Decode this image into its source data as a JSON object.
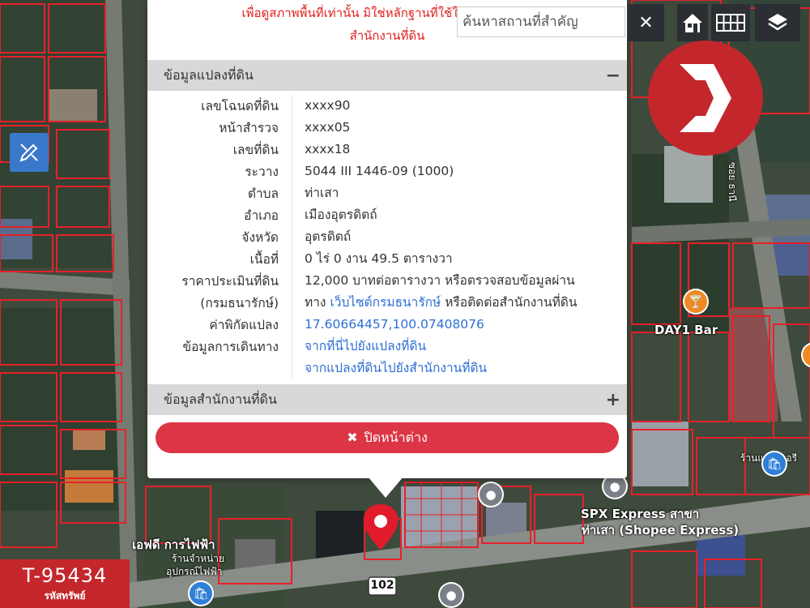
{
  "disclaimer": {
    "line1": "เพื่อดูสภาพพื้นที่เท่านั้น มิใช่หลักฐานที่ใช้ในทางกฎหมาย",
    "line2": "สำนักงานที่ดิน"
  },
  "search": {
    "placeholder": "ค้นหาสถานที่สำคัญ"
  },
  "controls": {
    "clear_icon": "close-icon",
    "home_icon": "home-icon",
    "grid_icon": "grid-icon",
    "layers_icon": "layers-icon",
    "draw_icon": "draw-tool-icon"
  },
  "popup": {
    "land_section": {
      "title": "ข้อมูลแปลงที่ดิน",
      "toggle": "−"
    },
    "office_section": {
      "title": "ข้อมูลสำนักงานที่ดิน",
      "toggle": "+"
    },
    "rows": [
      {
        "label": "เลขโฉนดที่ดิน",
        "value": "xxxx90"
      },
      {
        "label": "หน้าสำรวจ",
        "value": "xxxx05"
      },
      {
        "label": "เลขที่ดิน",
        "value": "xxxx18"
      },
      {
        "label": "ระวาง",
        "value": "5044 III 1446-09 (1000)"
      },
      {
        "label": "ตำบล",
        "value": "ท่าเสา"
      },
      {
        "label": "อำเภอ",
        "value": "เมืองอุตรดิตถ์"
      },
      {
        "label": "จังหวัด",
        "value": "อุตรดิตถ์"
      },
      {
        "label": "เนื้อที่",
        "value": "0 ไร่ 0 งาน 49.5 ตารางวา"
      }
    ],
    "price": {
      "label": "ราคาประเมินที่ดิน",
      "label2": "(กรมธนารักษ์)",
      "value": "12,000 บาทต่อตารางวา หรือตรวจสอบข้อมูลผ่าน",
      "value2_pre": "ทาง",
      "value2_link": "เว็บไซต์กรมธนารักษ์",
      "value2_post": "หรือติดต่อสำนักงานที่ดิน"
    },
    "coords": {
      "label": "ค่าพิกัดแปลง",
      "value": "17.60664457,100.07408076"
    },
    "directions": {
      "label": "ข้อมูลการเดินทาง",
      "link1": "จากที่นี่ไปยังแปลงที่ดิน",
      "link2": "จากแปลงที่ดินไปยังสำนักงานที่ดิน"
    },
    "close_button": {
      "icon": "✖",
      "label": "ปิดหน้าต่าง"
    }
  },
  "map_labels": {
    "day1_bar": "DAY1 Bar",
    "spx_line1": "SPX Express สาขา",
    "spx_line2": "ท่าเสา (Shopee Express)",
    "road_soi": "ซอย ธานี",
    "shop_right": "ร้านแบตเตอรี",
    "pea_line1": "เอฟดี การไฟฟ้า",
    "pea_line2": "ร้านจำหน่าย",
    "pea_line3": "อุปกรณ์ไฟฟ้า",
    "route_number": "102"
  },
  "badge": {
    "code": "T-95434",
    "caption": "รหัสทรัพย์"
  },
  "colors": {
    "accent_red": "#dc3545",
    "brand_red": "#c3272c",
    "link_blue": "#2d6fd3",
    "parcel_line": "#e8202a",
    "control_dark": "#2b2e33",
    "draw_button": "#3a78c9"
  }
}
